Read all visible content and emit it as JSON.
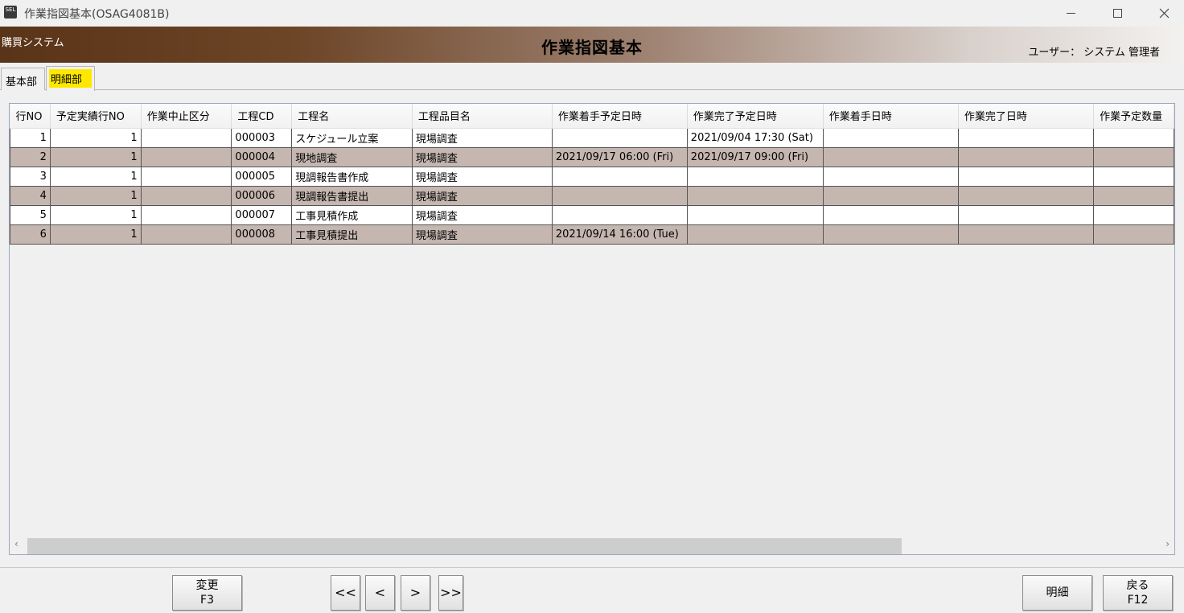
{
  "window": {
    "icon_text": "SEL",
    "title": "作業指図基本(OSAG4081B)"
  },
  "banner": {
    "system_name": "購買システム",
    "page_title": "作業指図基本",
    "user_info": "ユーザー： システム 管理者"
  },
  "tabs": [
    {
      "label": "基本部",
      "active": false
    },
    {
      "label": "明細部",
      "active": true
    }
  ],
  "colors": {
    "active_tab_highlight": "#ffe800",
    "alt_row": "#c5b6b0",
    "banner_dark": "#5a3418"
  },
  "grid": {
    "columns": [
      "行NO",
      "予定実績行NO",
      "作業中止区分",
      "工程CD",
      "工程名",
      "工程品目名",
      "作業着手予定日時",
      "作業完了予定日時",
      "作業着手日時",
      "作業完了日時",
      "作業予定数量"
    ],
    "rows": [
      [
        "1",
        "1",
        "",
        "000003",
        "スケジュール立案",
        "現場調査",
        "",
        "2021/09/04 17:30 (Sat)",
        "",
        "",
        ""
      ],
      [
        "2",
        "1",
        "",
        "000004",
        "現地調査",
        "現場調査",
        "2021/09/17 06:00 (Fri)",
        "2021/09/17 09:00 (Fri)",
        "",
        "",
        ""
      ],
      [
        "3",
        "1",
        "",
        "000005",
        "現調報告書作成",
        "現場調査",
        "",
        "",
        "",
        "",
        ""
      ],
      [
        "4",
        "1",
        "",
        "000006",
        "現調報告書提出",
        "現場調査",
        "",
        "",
        "",
        "",
        ""
      ],
      [
        "5",
        "1",
        "",
        "000007",
        "工事見積作成",
        "現場調査",
        "",
        "",
        "",
        "",
        ""
      ],
      [
        "6",
        "1",
        "",
        "000008",
        "工事見積提出",
        "現場調査",
        "2021/09/14 16:00 (Tue)",
        "",
        "",
        "",
        ""
      ]
    ]
  },
  "buttons": {
    "change": {
      "label": "変更",
      "key": "F3"
    },
    "first": "<<",
    "prev": "<",
    "next": ">",
    "last": ">>",
    "detail": "明細",
    "back": {
      "label": "戻る",
      "key": "F12"
    }
  },
  "scroll": {
    "left_arrow": "‹",
    "right_arrow": "›"
  }
}
